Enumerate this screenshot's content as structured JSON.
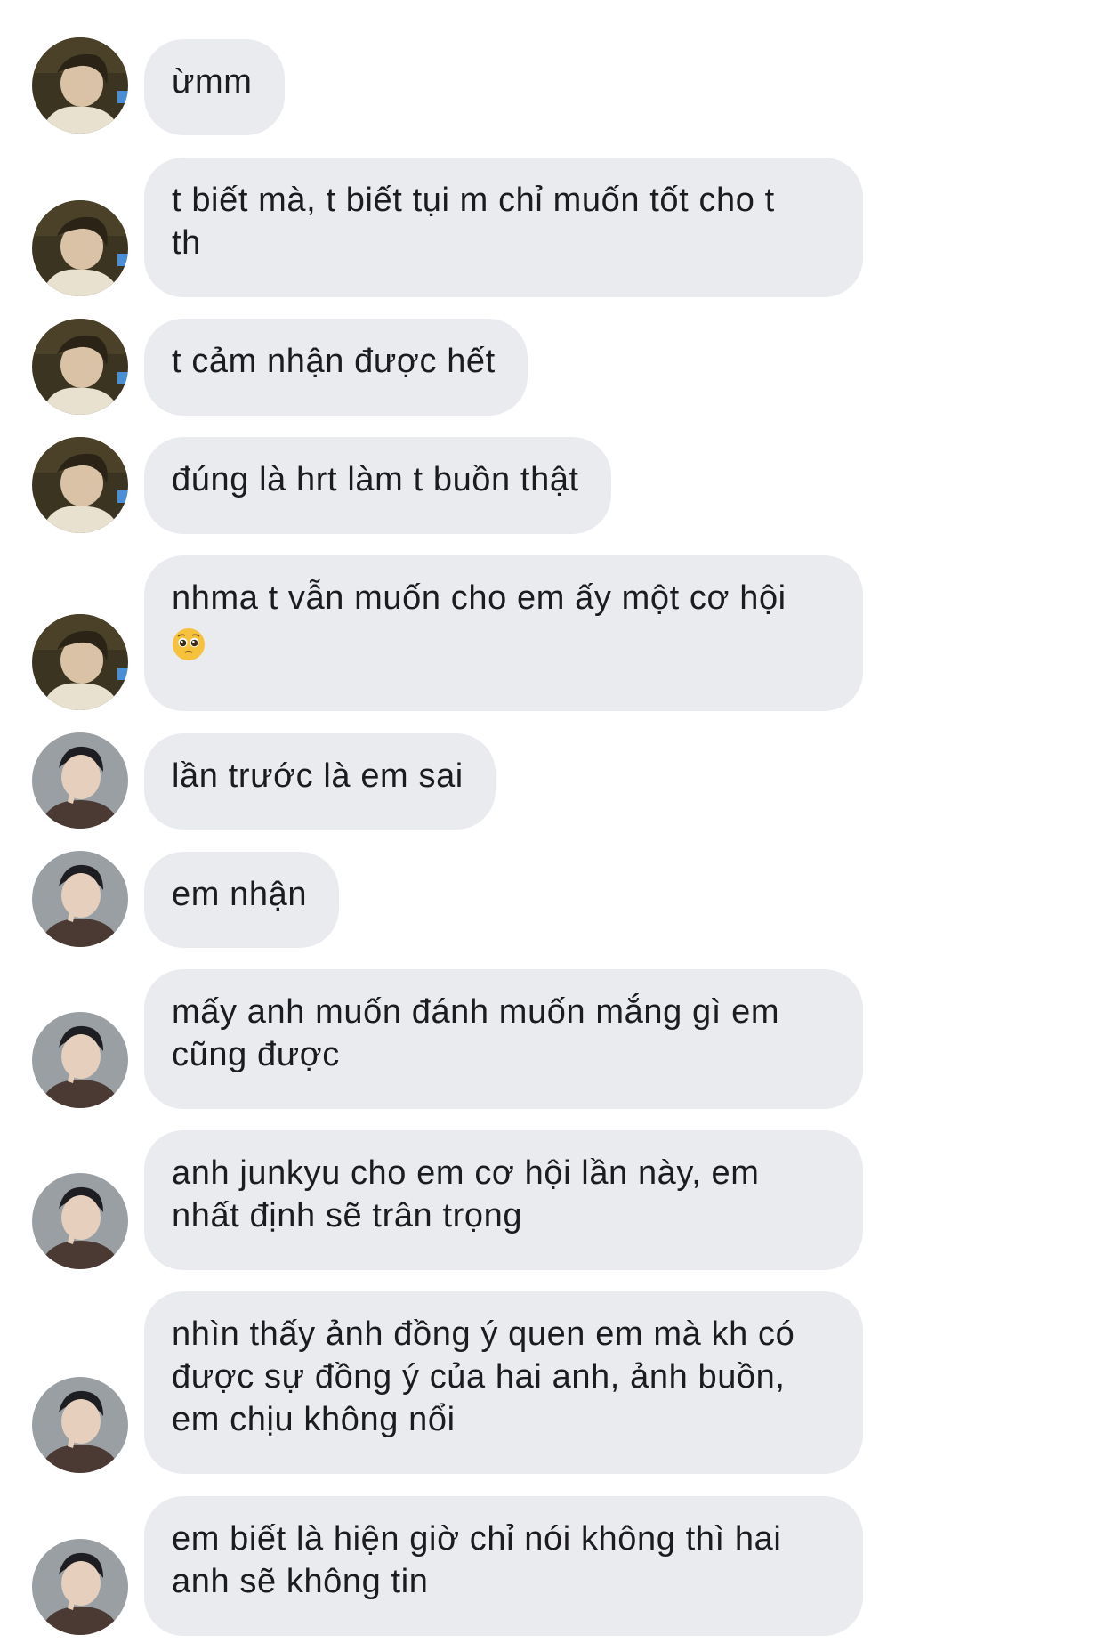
{
  "colors": {
    "bubble_bg": "#e9ebef",
    "text": "#1c1c1e",
    "page_bg": "#ffffff"
  },
  "messages": [
    {
      "sender": "junkyu",
      "lines": [
        "ừmm"
      ]
    },
    {
      "sender": "junkyu",
      "lines": [
        "t biết mà, t biết tụi m chỉ muốn tốt cho t",
        "th"
      ]
    },
    {
      "sender": "junkyu",
      "lines": [
        "t cảm nhận được hết"
      ]
    },
    {
      "sender": "junkyu",
      "lines": [
        "đúng là hrt làm t buồn thật"
      ]
    },
    {
      "sender": "junkyu",
      "lines": [
        "nhma t vẫn muốn cho em ấy một cơ hội"
      ],
      "emoji": "pleading-face"
    },
    {
      "sender": "other",
      "lines": [
        "lần trước là em sai"
      ]
    },
    {
      "sender": "other",
      "lines": [
        "em nhận"
      ]
    },
    {
      "sender": "other",
      "lines": [
        "mấy anh muốn đánh muốn mắng gì em",
        "cũng được"
      ]
    },
    {
      "sender": "other",
      "lines": [
        "anh junkyu cho em cơ hội lần này, em",
        "nhất định sẽ trân trọng"
      ]
    },
    {
      "sender": "other",
      "lines": [
        "nhìn thấy ảnh đồng ý quen em mà kh có",
        "được sự đồng ý của hai anh, ảnh buồn,",
        "em chịu không nổi"
      ]
    },
    {
      "sender": "other",
      "lines": [
        "em biết là hiện giờ chỉ nói không thì hai",
        "anh sẽ không tin"
      ]
    }
  ]
}
